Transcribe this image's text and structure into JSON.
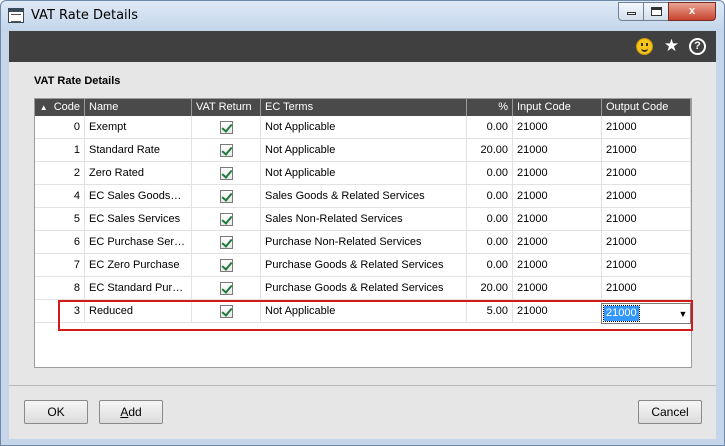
{
  "window": {
    "title": "VAT Rate Details",
    "minimize_label": "",
    "maximize_label": "",
    "close_label": "x"
  },
  "toolbar": {
    "icons": [
      "smiley-icon",
      "star-icon",
      "help-icon"
    ],
    "star_glyph": "★",
    "help_glyph": "?"
  },
  "section": {
    "title": "VAT Rate Details"
  },
  "grid": {
    "sort_glyph": "▲",
    "columns": [
      "Code",
      "Name",
      "VAT Return",
      "EC Terms",
      "%",
      "Input Code",
      "Output Code"
    ],
    "rows": [
      {
        "code": "0",
        "name": "Exempt",
        "vat_return": true,
        "ec_terms": "Not Applicable",
        "percent": "0.00",
        "input_code": "21000",
        "output_code": "21000"
      },
      {
        "code": "1",
        "name": "Standard Rate",
        "vat_return": true,
        "ec_terms": "Not Applicable",
        "percent": "20.00",
        "input_code": "21000",
        "output_code": "21000"
      },
      {
        "code": "2",
        "name": "Zero Rated",
        "vat_return": true,
        "ec_terms": "Not Applicable",
        "percent": "0.00",
        "input_code": "21000",
        "output_code": "21000"
      },
      {
        "code": "4",
        "name": "EC Sales Goods…",
        "vat_return": true,
        "ec_terms": "Sales Goods & Related Services",
        "percent": "0.00",
        "input_code": "21000",
        "output_code": "21000"
      },
      {
        "code": "5",
        "name": "EC Sales Services",
        "vat_return": true,
        "ec_terms": "Sales Non-Related Services",
        "percent": "0.00",
        "input_code": "21000",
        "output_code": "21000"
      },
      {
        "code": "6",
        "name": "EC Purchase Ser…",
        "vat_return": true,
        "ec_terms": "Purchase Non-Related Services",
        "percent": "0.00",
        "input_code": "21000",
        "output_code": "21000"
      },
      {
        "code": "7",
        "name": "EC Zero Purchase",
        "vat_return": true,
        "ec_terms": "Purchase Goods & Related Services",
        "percent": "0.00",
        "input_code": "21000",
        "output_code": "21000"
      },
      {
        "code": "8",
        "name": "EC Standard Pur…",
        "vat_return": true,
        "ec_terms": "Purchase Goods & Related Services",
        "percent": "20.00",
        "input_code": "21000",
        "output_code": "21000"
      }
    ],
    "edit_row": {
      "code": "3",
      "name": "Reduced",
      "vat_return": true,
      "ec_terms": "Not Applicable",
      "percent": "5.00",
      "input_code": "21000",
      "output_code": "21000"
    },
    "dropdown_arrow": "▼"
  },
  "buttons": {
    "ok": "OK",
    "add_prefix": "",
    "add_underlined": "A",
    "add_rest": "dd",
    "cancel": "Cancel"
  },
  "colors": {
    "toolbar_bg": "#404040",
    "header_bg": "#4a4a4a",
    "highlight_border": "#d11a1a",
    "selection": "#3399ff"
  }
}
